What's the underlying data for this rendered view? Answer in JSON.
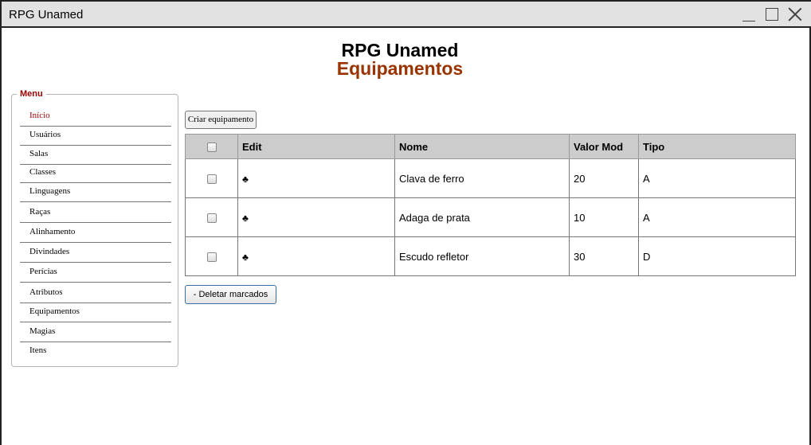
{
  "window": {
    "title": "RPG Unamed"
  },
  "header": {
    "title": "RPG Unamed",
    "subtitle": "Equipamentos"
  },
  "menu": {
    "legend": "Menu",
    "items": [
      {
        "label": "Início",
        "active": true
      },
      {
        "label": "Usuários"
      },
      {
        "label": "Salas"
      },
      {
        "label": "Classes"
      },
      {
        "label": "Linguagens"
      },
      {
        "label": "Raças"
      },
      {
        "label": "Alinhamento"
      },
      {
        "label": "Divindades"
      },
      {
        "label": "Perícias"
      },
      {
        "label": "Atributos"
      },
      {
        "label": "Equipamentos"
      },
      {
        "label": "Magias"
      },
      {
        "label": "Itens"
      }
    ]
  },
  "toolbar": {
    "create_label": "Criar equipamento",
    "delete_label": "- Deletar marcados"
  },
  "table": {
    "columns": [
      "Edit",
      "Nome",
      "Valor Mod",
      "Tipo"
    ],
    "edit_icon": "♣",
    "rows": [
      {
        "nome": "Clava de ferro",
        "valor_mod": "20",
        "tipo": "A"
      },
      {
        "nome": "Adaga de prata",
        "valor_mod": "10",
        "tipo": "A"
      },
      {
        "nome": "Escudo refletor",
        "valor_mod": "30",
        "tipo": "D"
      }
    ]
  },
  "colors": {
    "accent_red": "#990000",
    "subtitle_brown": "#993300",
    "header_gray": "#cccccc",
    "titlebar_gray": "#e2e2e2"
  }
}
